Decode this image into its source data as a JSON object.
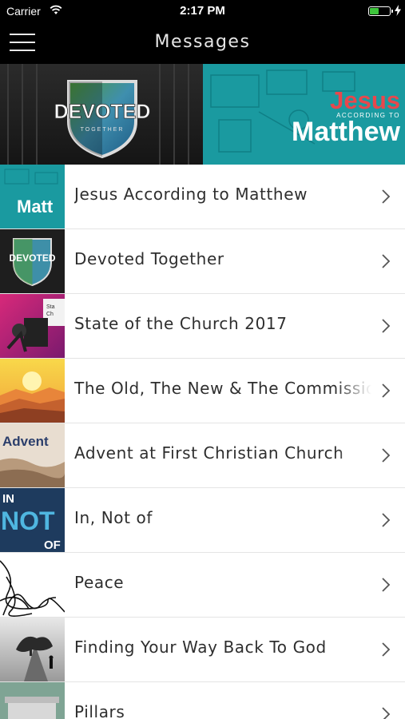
{
  "status_bar": {
    "carrier": "Carrier",
    "time": "2:17 PM",
    "battery_level": 0.45,
    "battery_color": "#3ec53c"
  },
  "nav": {
    "title": "Messages",
    "menu_icon": "hamburger-menu-icon"
  },
  "hero": {
    "left_logo": "DEVOTED",
    "left_logo_sub": "TOGETHER",
    "right_title_top": "Jesus",
    "right_title_small": "ACCORDING TO",
    "right_title_main": "Matthew"
  },
  "thumb_text": {
    "matthew": "Matt",
    "devoted": "DEVOTED",
    "advent": "Advent",
    "in": "IN",
    "not": "NOT",
    "of": "OF",
    "state_line1": "Sta",
    "state_line2": "Ch"
  },
  "messages": [
    {
      "title": "Jesus According to Matthew"
    },
    {
      "title": "Devoted Together"
    },
    {
      "title": "State of the Church 2017"
    },
    {
      "title": "The Old, The New & The Commission"
    },
    {
      "title": "Advent at First Christian Church"
    },
    {
      "title": "In, Not of"
    },
    {
      "title": "Peace"
    },
    {
      "title": "Finding Your Way Back To God"
    },
    {
      "title": "Pillars"
    }
  ],
  "colors": {
    "accent_red": "#e8474c",
    "teal": "#1a9aa0",
    "chevron": "#555555"
  }
}
